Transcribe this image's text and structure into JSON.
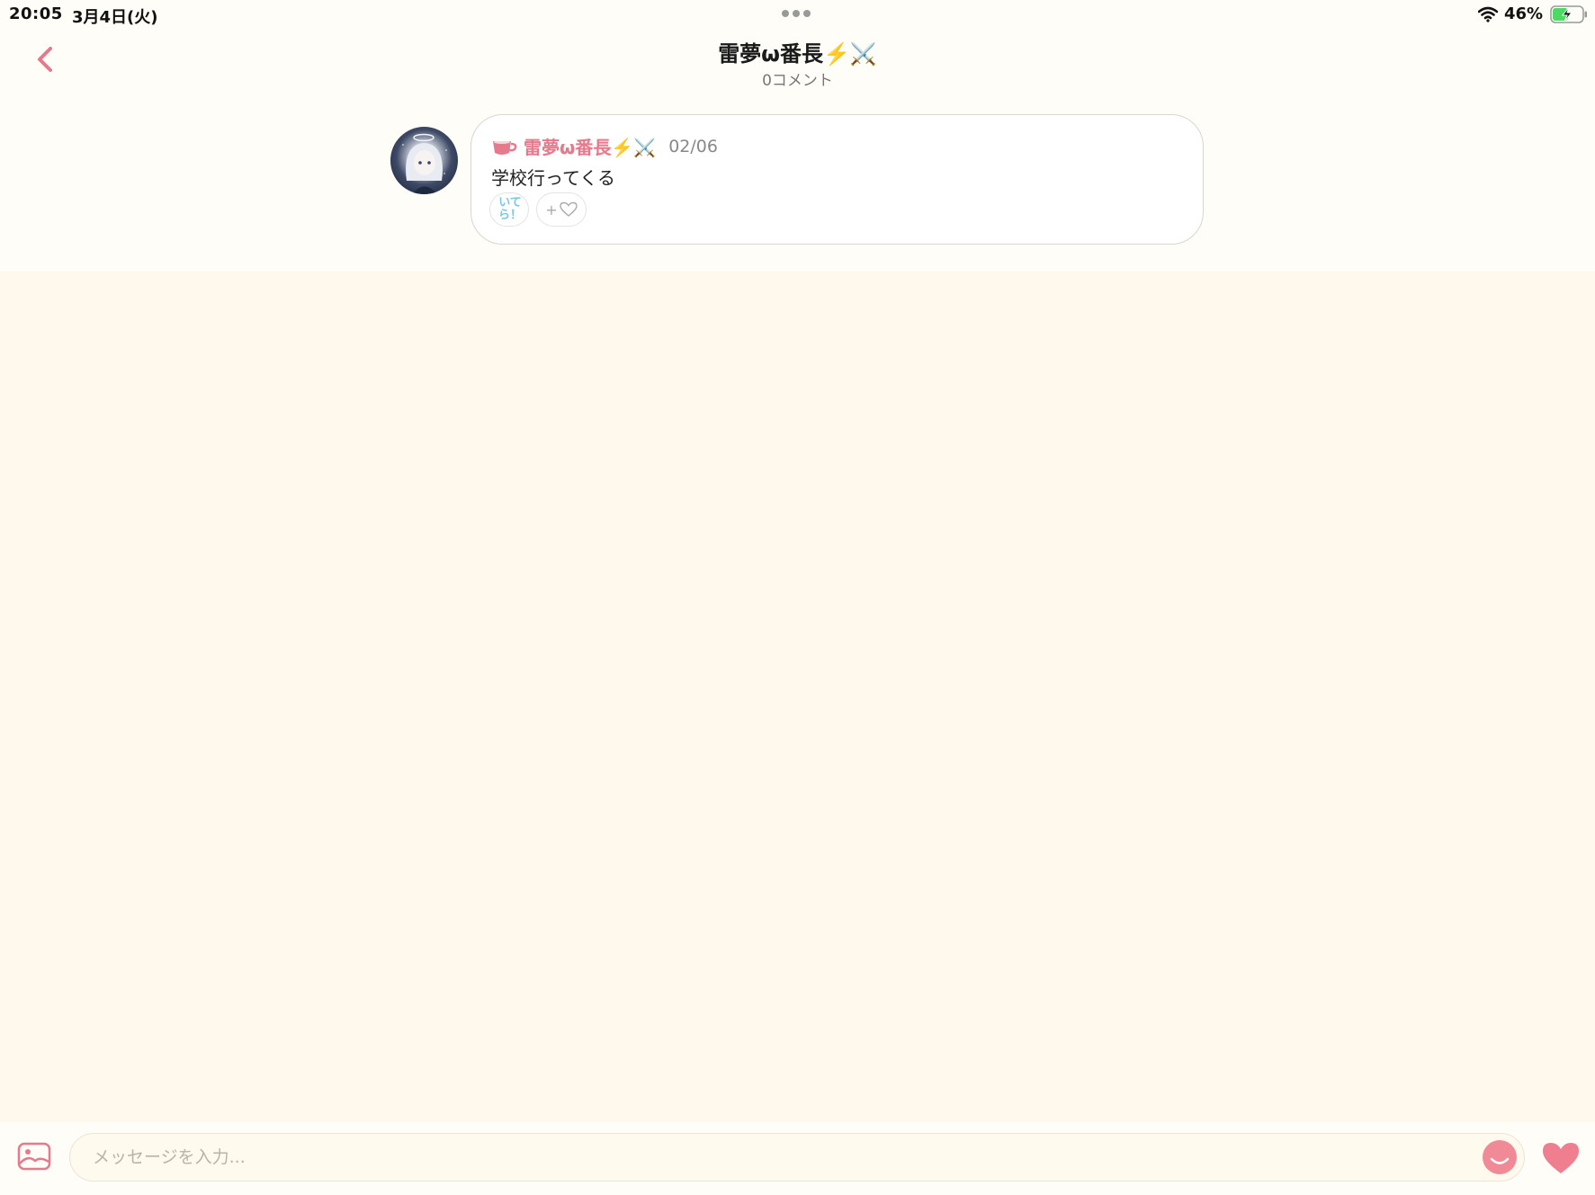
{
  "status_bar": {
    "time": "20:05",
    "date": "3月4日(火)",
    "battery": "46%"
  },
  "header": {
    "title": "雷夢ω番長⚡️⚔️",
    "subtitle": "0コメント"
  },
  "post": {
    "author": "雷夢ω番長⚡️⚔️",
    "date": "02/06",
    "body": "学校行ってくる",
    "stamp_label": "いてら！",
    "add_reaction_label": "+"
  },
  "input": {
    "placeholder": "メッセージを入力..."
  },
  "colors": {
    "accent": "#e57a8c",
    "background": "#fff8ec",
    "stamp": "#7cc7e3"
  }
}
